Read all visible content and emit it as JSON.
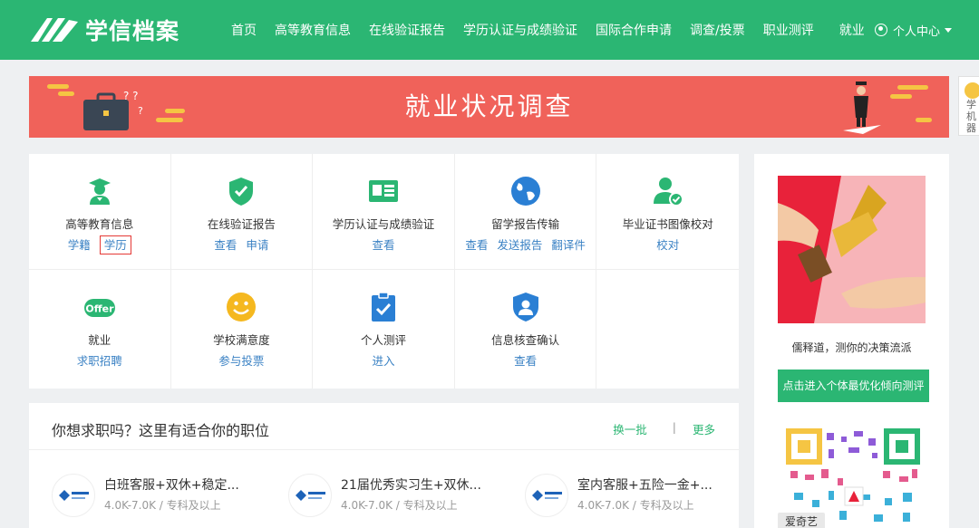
{
  "header": {
    "logo_text": "学信档案",
    "nav": [
      "首页",
      "高等教育信息",
      "在线验证报告",
      "学历认证与成绩验证",
      "国际合作申请",
      "调查/投票",
      "职业测评",
      "就业"
    ],
    "user_label": "个人中心",
    "brand_color": "#2bb673"
  },
  "banner": {
    "title": "就业状况调查",
    "color": "#f0625a"
  },
  "side_widget": {
    "lines": [
      "学",
      "机器"
    ]
  },
  "services": [
    {
      "title": "高等教育信息",
      "icon": "graduate-icon",
      "links": [
        "学籍",
        "学历"
      ]
    },
    {
      "title": "在线验证报告",
      "icon": "shield-check-icon",
      "links": [
        "查看",
        "申请"
      ]
    },
    {
      "title": "学历认证与成绩验证",
      "icon": "id-card-icon",
      "links": [
        "查看"
      ]
    },
    {
      "title": "留学报告传输",
      "icon": "globe-icon",
      "links": [
        "查看",
        "发送报告",
        "翻译件"
      ]
    },
    {
      "title": "毕业证书图像校对",
      "icon": "user-check-icon",
      "links": [
        "校对"
      ]
    },
    {
      "title": "就业",
      "icon": "offer-icon",
      "icon_text": "Offer",
      "links": [
        "求职招聘"
      ]
    },
    {
      "title": "学校满意度",
      "icon": "smile-icon",
      "links": [
        "参与投票"
      ]
    },
    {
      "title": "个人测评",
      "icon": "clipboard-check-icon",
      "links": [
        "进入"
      ]
    },
    {
      "title": "信息核查确认",
      "icon": "shield-user-icon",
      "links": [
        "查看"
      ]
    }
  ],
  "jobs": {
    "title": "你想求职吗？这里有适合你的职位",
    "refresh_label": "换一批",
    "separator": "|",
    "more_label": "更多",
    "items": [
      {
        "title": "白班客服+双休+稳定...",
        "meta": "4.0K-7.0K / 专科及以上"
      },
      {
        "title": "21届优秀实习生+双休...",
        "meta": "4.0K-7.0K / 专科及以上"
      },
      {
        "title": "室内客服+五险一金+...",
        "meta": "4.0K-7.0K / 专科及以上"
      }
    ]
  },
  "right": {
    "caption": "儒释道，测你的决策流派",
    "button_label": "点击进入个体最优化倾向测评",
    "qr_label": "爱奇艺"
  }
}
